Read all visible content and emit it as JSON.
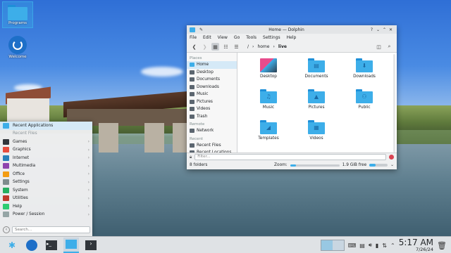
{
  "desktop": {
    "icons": [
      {
        "label": "Programs",
        "icon": "folder-icon"
      },
      {
        "label": "Welcome",
        "icon": "welcome-icon"
      }
    ]
  },
  "dolphin": {
    "title": "Home — Dolphin",
    "window_buttons": [
      "?",
      "⌄",
      "⌃",
      "✕"
    ],
    "menu": [
      "File",
      "Edit",
      "View",
      "Go",
      "Tools",
      "Settings",
      "Help"
    ],
    "breadcrumb": [
      "/",
      "home",
      "live"
    ],
    "places": {
      "sections": [
        {
          "title": "Places",
          "items": [
            "Home",
            "Desktop",
            "Documents",
            "Downloads",
            "Music",
            "Pictures",
            "Videos",
            "Trash"
          ]
        },
        {
          "title": "Remote",
          "items": [
            "Network"
          ]
        },
        {
          "title": "Recent",
          "items": [
            "Recent Files",
            "Recent Locations"
          ]
        }
      ],
      "active": "Home"
    },
    "files": [
      {
        "name": "Desktop",
        "icon": "desktop-folder-icon"
      },
      {
        "name": "Documents",
        "icon": "documents-folder-icon",
        "glyph": "▤"
      },
      {
        "name": "Downloads",
        "icon": "downloads-folder-icon",
        "glyph": "⬇"
      },
      {
        "name": "Music",
        "icon": "music-folder-icon",
        "glyph": "♫"
      },
      {
        "name": "Pictures",
        "icon": "pictures-folder-icon",
        "glyph": "▲"
      },
      {
        "name": "Public",
        "icon": "public-folder-icon",
        "glyph": "⚇"
      },
      {
        "name": "Templates",
        "icon": "templates-folder-icon",
        "glyph": "◢"
      },
      {
        "name": "Videos",
        "icon": "videos-folder-icon",
        "glyph": "▦"
      }
    ],
    "filter_placeholder": "Filter...",
    "status": {
      "folder_count": "8 folders",
      "zoom_label": "Zoom:",
      "zoom_level": 0.12,
      "free_space": "1.9 GiB free",
      "used_fraction": 0.35
    }
  },
  "launcher": {
    "items": [
      {
        "label": "Recent Applications",
        "color": "#3daee9",
        "arrow": false,
        "active": true
      },
      {
        "label": "Recent Files",
        "color": "transparent",
        "arrow": false,
        "dim": true
      },
      {
        "label": "Games",
        "color": "#31363b",
        "arrow": true
      },
      {
        "label": "Graphics",
        "color": "#e74c3c",
        "arrow": true
      },
      {
        "label": "Internet",
        "color": "#2980b9",
        "arrow": true
      },
      {
        "label": "Multimedia",
        "color": "#8e44ad",
        "arrow": true
      },
      {
        "label": "Office",
        "color": "#f39c12",
        "arrow": true
      },
      {
        "label": "Settings",
        "color": "#7f8c8d",
        "arrow": true
      },
      {
        "label": "System",
        "color": "#27ae60",
        "arrow": true
      },
      {
        "label": "Utilities",
        "color": "#c0392b",
        "arrow": true
      },
      {
        "label": "Help",
        "color": "#2ecc71",
        "arrow": true
      },
      {
        "label": "Power / Session",
        "color": "#95a5a6",
        "arrow": true
      }
    ],
    "search_placeholder": "Search..."
  },
  "taskbar": {
    "time": "5:17 AM",
    "date": "7/26/24"
  }
}
